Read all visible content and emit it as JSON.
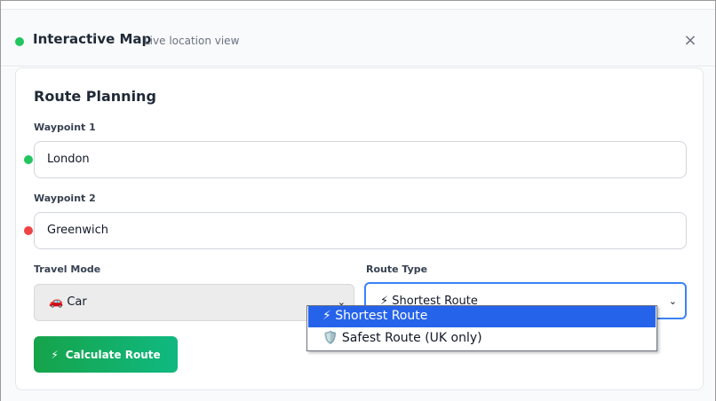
{
  "header": {
    "title": "Interactive Map",
    "subtitle": "Live location view",
    "close_glyph": "×",
    "status_color": "#22c55e"
  },
  "route": {
    "section_title": "Route Planning",
    "waypoint1": {
      "label": "Waypoint 1",
      "value": "London",
      "dot_color": "#22c55e"
    },
    "waypoint2": {
      "label": "Waypoint 2",
      "value": "Greenwich",
      "dot_color": "#ef4444"
    },
    "travel_mode": {
      "label": "Travel Mode",
      "selected": "🚗 Car"
    },
    "route_type": {
      "label": "Route Type",
      "selected": "⚡ Shortest Route",
      "options": [
        "⚡ Shortest Route",
        "🛡️ Safest Route (UK only)"
      ]
    },
    "calculate": {
      "icon": "⚡",
      "label": "Calculate Route"
    }
  },
  "icons": {
    "close": "close-icon",
    "chevron": "chevron-down-icon",
    "bolt": "lightning-icon"
  }
}
